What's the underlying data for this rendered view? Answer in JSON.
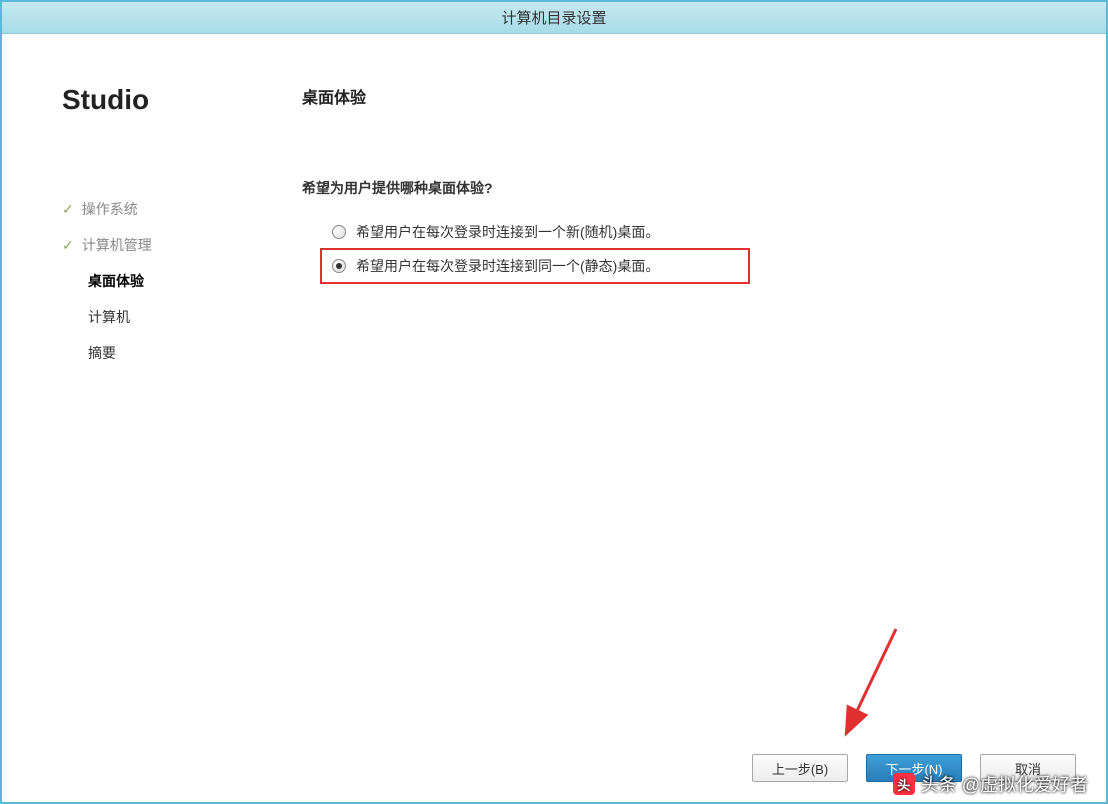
{
  "title": "计算机目录设置",
  "brand": "Studio",
  "steps": [
    {
      "label": "操作系统",
      "state": "done"
    },
    {
      "label": "计算机管理",
      "state": "done"
    },
    {
      "label": "桌面体验",
      "state": "current"
    },
    {
      "label": "计算机",
      "state": "future"
    },
    {
      "label": "摘要",
      "state": "future"
    }
  ],
  "page_title": "桌面体验",
  "question": "希望为用户提供哪种桌面体验?",
  "options": [
    {
      "label": "希望用户在每次登录时连接到一个新(随机)桌面。",
      "selected": false,
      "highlighted": false
    },
    {
      "label": "希望用户在每次登录时连接到同一个(静态)桌面。",
      "selected": true,
      "highlighted": true
    }
  ],
  "buttons": {
    "back": "上一步(B)",
    "next": "下一步(N)",
    "cancel": "取消"
  },
  "watermark": "头条 @虚拟化爱好者"
}
